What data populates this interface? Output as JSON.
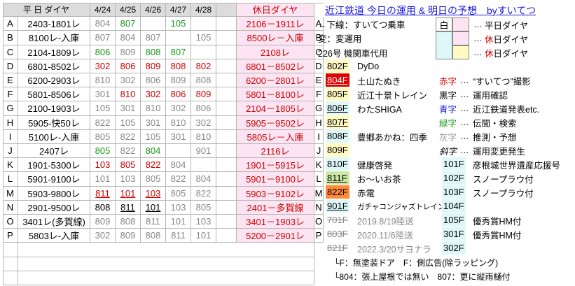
{
  "header": {
    "row_label": "平 日 ダイヤ",
    "dates": [
      "4/24",
      "4/25",
      "4/26",
      "4/27",
      "4/28"
    ],
    "holiday_label": "休日ダイヤ"
  },
  "title": "近江鉄道 今日の運用 & 明日の予想　byすいてつ",
  "rows": [
    {
      "letter": "A",
      "weekday": "2403-1801レ",
      "d": [
        {
          "v": "804",
          "s": "grey"
        },
        {
          "v": "807",
          "s": "green"
        },
        {
          "v": "",
          "s": ""
        },
        {
          "v": "105",
          "s": "green"
        },
        {
          "v": "",
          "s": ""
        }
      ],
      "holiday": "2106－1911レ"
    },
    {
      "letter": "B",
      "weekday": "8100レ-入庫",
      "d": [
        {
          "v": "807",
          "s": "grey"
        },
        {
          "v": "804",
          "s": "grey"
        },
        {
          "v": "807",
          "s": "grey"
        },
        {
          "v": "",
          "s": ""
        },
        {
          "v": "105",
          "s": "grey"
        }
      ],
      "holiday": "8500レ－入庫"
    },
    {
      "letter": "C",
      "weekday": "2104-1809レ",
      "d": [
        {
          "v": "806",
          "s": "green"
        },
        {
          "v": "809",
          "s": "grey"
        },
        {
          "v": "808",
          "s": "green"
        },
        {
          "v": "807",
          "s": "green"
        },
        {
          "v": "",
          "s": ""
        }
      ],
      "holiday": "2108レ"
    },
    {
      "letter": "D",
      "weekday": "6801-8502レ",
      "d": [
        {
          "v": "302",
          "s": "red"
        },
        {
          "v": "806",
          "s": "red"
        },
        {
          "v": "809",
          "s": "red"
        },
        {
          "v": "808",
          "s": "red"
        },
        {
          "v": "802",
          "s": "red"
        }
      ],
      "holiday": "6801－8502レ"
    },
    {
      "letter": "E",
      "weekday": "6200-2903レ",
      "d": [
        {
          "v": "810",
          "s": "grey"
        },
        {
          "v": "302",
          "s": "grey"
        },
        {
          "v": "806",
          "s": "grey"
        },
        {
          "v": "809",
          "s": "grey"
        },
        {
          "v": "808",
          "s": "grey"
        }
      ],
      "holiday": "6200－2801レ"
    },
    {
      "letter": "F",
      "weekday": "5801-8506レ",
      "d": [
        {
          "v": "301",
          "s": "grey"
        },
        {
          "v": "810",
          "s": "red"
        },
        {
          "v": "302",
          "s": "red"
        },
        {
          "v": "806",
          "s": "red"
        },
        {
          "v": "809",
          "s": "red"
        }
      ],
      "holiday": "5801－8100レ"
    },
    {
      "letter": "G",
      "weekday": "2100-1903レ",
      "d": [
        {
          "v": "105",
          "s": "grey"
        },
        {
          "v": "301",
          "s": "grey"
        },
        {
          "v": "810",
          "s": "grey"
        },
        {
          "v": "302",
          "s": "grey"
        },
        {
          "v": "806",
          "s": "grey"
        }
      ],
      "holiday": "2104－1805レ"
    },
    {
      "letter": "H",
      "weekday": "5905-快50レ",
      "d": [
        {
          "v": "822",
          "s": "grey"
        },
        {
          "v": "105",
          "s": "grey"
        },
        {
          "v": "301",
          "s": "grey"
        },
        {
          "v": "810",
          "s": "grey"
        },
        {
          "v": "302",
          "s": "grey"
        }
      ],
      "holiday": "5905－9502レ"
    },
    {
      "letter": "I",
      "weekday": "5100レ-入庫",
      "d": [
        {
          "v": "805",
          "s": "grey"
        },
        {
          "v": "822",
          "s": "grey"
        },
        {
          "v": "105",
          "s": "grey"
        },
        {
          "v": "301",
          "s": "grey"
        },
        {
          "v": "810",
          "s": "grey"
        }
      ],
      "holiday": "5805レ－入庫"
    },
    {
      "letter": "J",
      "weekday": "2407レ",
      "d": [
        {
          "v": "805",
          "s": "green"
        },
        {
          "v": "822",
          "s": "grey"
        },
        {
          "v": "804",
          "s": "green"
        },
        {
          "v": "",
          "s": ""
        },
        {
          "v": "901",
          "s": "grey"
        }
      ],
      "holiday": "2116レ"
    },
    {
      "letter": "K",
      "weekday": "1901-5300レ",
      "d": [
        {
          "v": "103",
          "s": "red"
        },
        {
          "v": "805",
          "s": "red"
        },
        {
          "v": "822",
          "s": "red"
        },
        {
          "v": "804",
          "s": "grey"
        },
        {
          "v": "",
          "s": ""
        }
      ],
      "holiday": "1901－5915レ"
    },
    {
      "letter": "L",
      "weekday": "5901-9100レ",
      "d": [
        {
          "v": "101",
          "s": "grey"
        },
        {
          "v": "103",
          "s": "grey"
        },
        {
          "v": "805",
          "s": "grey"
        },
        {
          "v": "822",
          "s": "grey"
        },
        {
          "v": "804",
          "s": "grey"
        }
      ],
      "holiday": "5901－9100レ"
    },
    {
      "letter": "M",
      "weekday": "5903-9800レ",
      "d": [
        {
          "v": "811",
          "s": "red ul"
        },
        {
          "v": "101",
          "s": "red ul"
        },
        {
          "v": "103",
          "s": "red ul"
        },
        {
          "v": "805",
          "s": "grey"
        },
        {
          "v": "822",
          "s": "grey"
        }
      ],
      "holiday": "5903－9102レ"
    },
    {
      "letter": "N",
      "weekday": "2901-9500レ",
      "d": [
        {
          "v": "808",
          "s": ""
        },
        {
          "v": "811",
          "s": "ul"
        },
        {
          "v": "101",
          "s": "ul"
        },
        {
          "v": "103",
          "s": "grey"
        },
        {
          "v": "805",
          "s": "grey"
        }
      ],
      "holiday": "2401－多賀線"
    },
    {
      "letter": "O",
      "weekday": "3401レ(多賀線)",
      "d": [
        {
          "v": "809",
          "s": "grey"
        },
        {
          "v": "808",
          "s": "grey"
        },
        {
          "v": "811",
          "s": "grey"
        },
        {
          "v": "101",
          "s": "grey"
        },
        {
          "v": "103",
          "s": "grey"
        }
      ],
      "holiday": "3401－1903レ"
    },
    {
      "letter": "P",
      "weekday": "5803レ-入庫",
      "d": [
        {
          "v": "302",
          "s": "grey"
        },
        {
          "v": "809",
          "s": "grey"
        },
        {
          "v": "808",
          "s": "grey"
        },
        {
          "v": "811",
          "s": "grey"
        },
        {
          "v": "101",
          "s": "grey"
        }
      ],
      "holiday": "5200－2901レ"
    }
  ],
  "legend_top": {
    "row1": "←下線：すいてつ乗車",
    "row1_underline": "下線",
    "row2": "変：変運用",
    "row3": "226号 機関車代用",
    "box_label_1": "白",
    "dots": "…",
    "weekday": "平日ダイヤ",
    "holiday_red": "休",
    "holiday_rest": "日ダイヤ"
  },
  "cars": [
    {
      "num": "802F",
      "name": "DyDo",
      "bg": "#fff9c4"
    },
    {
      "num": "804F",
      "name": "土山たぬき",
      "bg": "#e00000"
    },
    {
      "num": "805F",
      "name": "近江十景トレイン",
      "bg": "#fff9c4"
    },
    {
      "num": "806F",
      "name": "わたSHIGA",
      "bg": "#e0f7fa"
    },
    {
      "num": "807F",
      "name": "",
      "bg": "#fff9c4"
    },
    {
      "num": "808F",
      "name": "豊郷あかね：四季",
      "bg": "#e0f7fa"
    },
    {
      "num": "809F",
      "name": "",
      "bg": "#fff9c4"
    },
    {
      "num": "810F",
      "name": "健康啓発",
      "bg": "#e0f7fa"
    },
    {
      "num": "811F",
      "name": "お～いお茶",
      "bg": "#cde8a4"
    },
    {
      "num": "822F",
      "name": "赤電",
      "bg": "#ff8a3c"
    },
    {
      "num": "901F",
      "name": "ガチャコンジャズトレイン",
      "bg": "#e0f7fa"
    },
    {
      "num": "701F",
      "name": "2019.8/19陸送",
      "bg": ""
    },
    {
      "num": "803F",
      "name": "2020.11/6陸送",
      "bg": ""
    },
    {
      "num": "821F",
      "name": "2022.3/20サヨナラ",
      "bg": ""
    }
  ],
  "meanings": [
    {
      "key": "赤字",
      "text": "“すいてつ”撮影",
      "color": "#d00000"
    },
    {
      "key": "黒字",
      "text": "運用確認",
      "color": "#000000"
    },
    {
      "key": "青字",
      "text": "近江鉄道発表etc.",
      "color": "#1a1adc"
    },
    {
      "key": "緑字",
      "text": "伝聞・検索",
      "color": "#1a9a1a"
    },
    {
      "key": "灰字",
      "text": "推測・予想",
      "color": "#999999"
    },
    {
      "key": "斜字",
      "text": "運用変更発生",
      "color": "#000000"
    }
  ],
  "small_cars": [
    {
      "num": "101F",
      "name": "彦根城世界遺産応援号"
    },
    {
      "num": "102F",
      "name": "スノープラウ付"
    },
    {
      "num": "103F",
      "name": "スノープラウ付"
    },
    {
      "num": "104F",
      "name": ""
    },
    {
      "num": "105F",
      "name": "優秀賞HM付"
    },
    {
      "num": "301F",
      "name": "優秀賞HM付"
    },
    {
      "num": "302F",
      "name": ""
    }
  ],
  "footnotes": {
    "f1": "└F：無塗装ドア　F：側広告(除ラッピング)",
    "f2": "└804：張上屋根では無い　807：更に縦雨樋付"
  },
  "colors": {
    "holiday_bg": "#fce4f2",
    "header_bg": "#dcdcdc",
    "title": "#1a1adc"
  }
}
